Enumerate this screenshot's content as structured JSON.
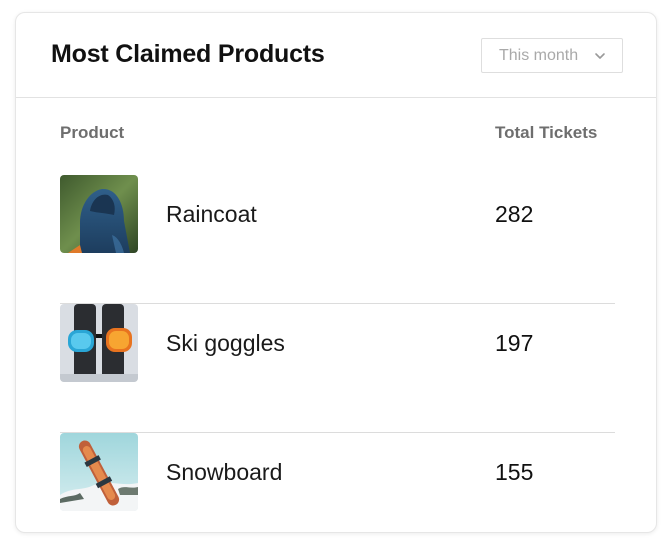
{
  "card": {
    "title": "Most Claimed Products",
    "period_select": {
      "value": "This month",
      "icon": "chevron-down-icon"
    }
  },
  "table": {
    "columns": {
      "product": "Product",
      "total_tickets": "Total Tickets"
    },
    "rows": [
      {
        "name": "Raincoat",
        "tickets": "282",
        "thumbnail": "raincoat-photo"
      },
      {
        "name": "Ski goggles",
        "tickets": "197",
        "thumbnail": "ski-goggles-photo"
      },
      {
        "name": "Snowboard",
        "tickets": "155",
        "thumbnail": "snowboard-photo"
      }
    ]
  }
}
